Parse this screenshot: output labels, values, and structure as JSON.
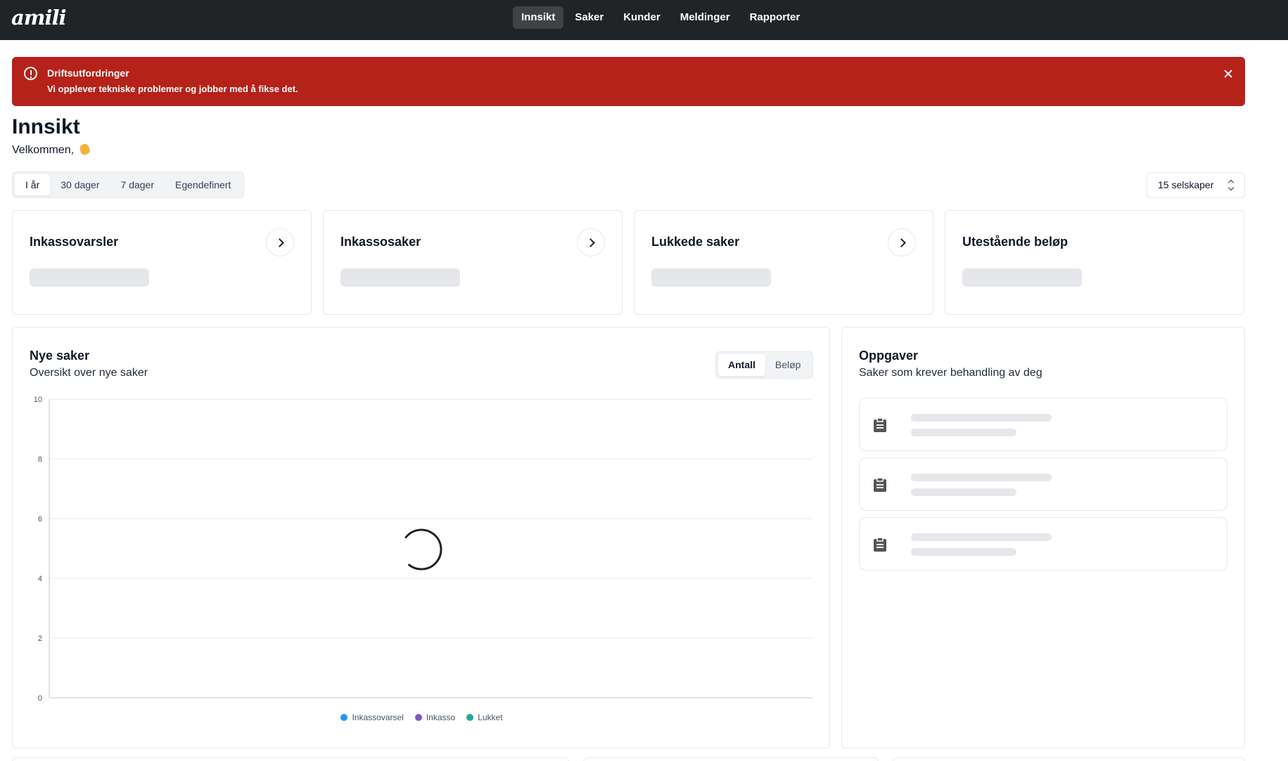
{
  "header": {
    "logo": "amili",
    "nav": [
      {
        "label": "Innsikt",
        "active": true
      },
      {
        "label": "Saker",
        "active": false
      },
      {
        "label": "Kunder",
        "active": false
      },
      {
        "label": "Meldinger",
        "active": false
      },
      {
        "label": "Rapporter",
        "active": false
      }
    ]
  },
  "alert": {
    "title": "Driftsutfordringer",
    "message": "Vi opplever tekniske problemer og jobber med å fikse det.",
    "color": "#b5221a"
  },
  "page": {
    "title": "Innsikt",
    "welcome": "Velkommen,"
  },
  "periods": [
    {
      "label": "I år",
      "active": true
    },
    {
      "label": "30 dager",
      "active": false
    },
    {
      "label": "7 dager",
      "active": false
    },
    {
      "label": "Egendefinert",
      "active": false
    }
  ],
  "company_select": {
    "value": "15 selskaper"
  },
  "stats": [
    {
      "title": "Inkassovarsler",
      "has_link": true
    },
    {
      "title": "Inkassosaker",
      "has_link": true
    },
    {
      "title": "Lukkede saker",
      "has_link": true
    },
    {
      "title": "Utestående beløp",
      "has_link": false
    }
  ],
  "chart_card": {
    "title": "Nye saker",
    "subtitle": "Oversikt over nye saker",
    "toggle": [
      {
        "label": "Antall",
        "active": true
      },
      {
        "label": "Beløp",
        "active": false
      }
    ],
    "loading": true
  },
  "chart_data": {
    "type": "line",
    "ylim": [
      0,
      10
    ],
    "yticks": [
      "0",
      "2",
      "4",
      "6",
      "8",
      "10"
    ],
    "series": [
      {
        "name": "Inkassovarsel",
        "color": "#2196f3",
        "values": []
      },
      {
        "name": "Inkasso",
        "color": "#7e57c2",
        "values": []
      },
      {
        "name": "Lukket",
        "color": "#26a69a",
        "values": []
      }
    ],
    "grid": true,
    "legend": "bottom"
  },
  "tasks_card": {
    "title": "Oppgaver",
    "subtitle": "Saker som krever behandling av deg",
    "items": [
      {
        "icon": "clipboard-icon",
        "loading": true
      },
      {
        "icon": "clipboard-icon",
        "loading": true
      },
      {
        "icon": "clipboard-icon",
        "loading": true
      }
    ]
  }
}
